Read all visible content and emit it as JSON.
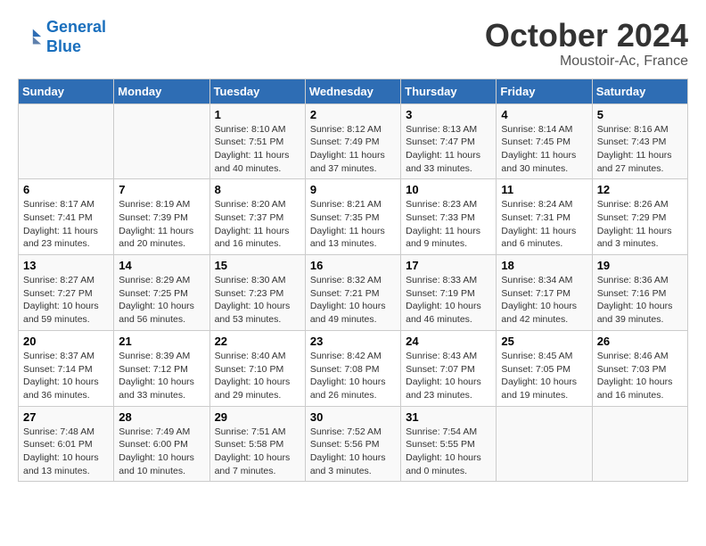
{
  "logo": {
    "line1": "General",
    "line2": "Blue"
  },
  "title": "October 2024",
  "location": "Moustoir-Ac, France",
  "days_of_week": [
    "Sunday",
    "Monday",
    "Tuesday",
    "Wednesday",
    "Thursday",
    "Friday",
    "Saturday"
  ],
  "weeks": [
    [
      {
        "day": "",
        "info": ""
      },
      {
        "day": "",
        "info": ""
      },
      {
        "day": "1",
        "info": "Sunrise: 8:10 AM\nSunset: 7:51 PM\nDaylight: 11 hours and 40 minutes."
      },
      {
        "day": "2",
        "info": "Sunrise: 8:12 AM\nSunset: 7:49 PM\nDaylight: 11 hours and 37 minutes."
      },
      {
        "day": "3",
        "info": "Sunrise: 8:13 AM\nSunset: 7:47 PM\nDaylight: 11 hours and 33 minutes."
      },
      {
        "day": "4",
        "info": "Sunrise: 8:14 AM\nSunset: 7:45 PM\nDaylight: 11 hours and 30 minutes."
      },
      {
        "day": "5",
        "info": "Sunrise: 8:16 AM\nSunset: 7:43 PM\nDaylight: 11 hours and 27 minutes."
      }
    ],
    [
      {
        "day": "6",
        "info": "Sunrise: 8:17 AM\nSunset: 7:41 PM\nDaylight: 11 hours and 23 minutes."
      },
      {
        "day": "7",
        "info": "Sunrise: 8:19 AM\nSunset: 7:39 PM\nDaylight: 11 hours and 20 minutes."
      },
      {
        "day": "8",
        "info": "Sunrise: 8:20 AM\nSunset: 7:37 PM\nDaylight: 11 hours and 16 minutes."
      },
      {
        "day": "9",
        "info": "Sunrise: 8:21 AM\nSunset: 7:35 PM\nDaylight: 11 hours and 13 minutes."
      },
      {
        "day": "10",
        "info": "Sunrise: 8:23 AM\nSunset: 7:33 PM\nDaylight: 11 hours and 9 minutes."
      },
      {
        "day": "11",
        "info": "Sunrise: 8:24 AM\nSunset: 7:31 PM\nDaylight: 11 hours and 6 minutes."
      },
      {
        "day": "12",
        "info": "Sunrise: 8:26 AM\nSunset: 7:29 PM\nDaylight: 11 hours and 3 minutes."
      }
    ],
    [
      {
        "day": "13",
        "info": "Sunrise: 8:27 AM\nSunset: 7:27 PM\nDaylight: 10 hours and 59 minutes."
      },
      {
        "day": "14",
        "info": "Sunrise: 8:29 AM\nSunset: 7:25 PM\nDaylight: 10 hours and 56 minutes."
      },
      {
        "day": "15",
        "info": "Sunrise: 8:30 AM\nSunset: 7:23 PM\nDaylight: 10 hours and 53 minutes."
      },
      {
        "day": "16",
        "info": "Sunrise: 8:32 AM\nSunset: 7:21 PM\nDaylight: 10 hours and 49 minutes."
      },
      {
        "day": "17",
        "info": "Sunrise: 8:33 AM\nSunset: 7:19 PM\nDaylight: 10 hours and 46 minutes."
      },
      {
        "day": "18",
        "info": "Sunrise: 8:34 AM\nSunset: 7:17 PM\nDaylight: 10 hours and 42 minutes."
      },
      {
        "day": "19",
        "info": "Sunrise: 8:36 AM\nSunset: 7:16 PM\nDaylight: 10 hours and 39 minutes."
      }
    ],
    [
      {
        "day": "20",
        "info": "Sunrise: 8:37 AM\nSunset: 7:14 PM\nDaylight: 10 hours and 36 minutes."
      },
      {
        "day": "21",
        "info": "Sunrise: 8:39 AM\nSunset: 7:12 PM\nDaylight: 10 hours and 33 minutes."
      },
      {
        "day": "22",
        "info": "Sunrise: 8:40 AM\nSunset: 7:10 PM\nDaylight: 10 hours and 29 minutes."
      },
      {
        "day": "23",
        "info": "Sunrise: 8:42 AM\nSunset: 7:08 PM\nDaylight: 10 hours and 26 minutes."
      },
      {
        "day": "24",
        "info": "Sunrise: 8:43 AM\nSunset: 7:07 PM\nDaylight: 10 hours and 23 minutes."
      },
      {
        "day": "25",
        "info": "Sunrise: 8:45 AM\nSunset: 7:05 PM\nDaylight: 10 hours and 19 minutes."
      },
      {
        "day": "26",
        "info": "Sunrise: 8:46 AM\nSunset: 7:03 PM\nDaylight: 10 hours and 16 minutes."
      }
    ],
    [
      {
        "day": "27",
        "info": "Sunrise: 7:48 AM\nSunset: 6:01 PM\nDaylight: 10 hours and 13 minutes."
      },
      {
        "day": "28",
        "info": "Sunrise: 7:49 AM\nSunset: 6:00 PM\nDaylight: 10 hours and 10 minutes."
      },
      {
        "day": "29",
        "info": "Sunrise: 7:51 AM\nSunset: 5:58 PM\nDaylight: 10 hours and 7 minutes."
      },
      {
        "day": "30",
        "info": "Sunrise: 7:52 AM\nSunset: 5:56 PM\nDaylight: 10 hours and 3 minutes."
      },
      {
        "day": "31",
        "info": "Sunrise: 7:54 AM\nSunset: 5:55 PM\nDaylight: 10 hours and 0 minutes."
      },
      {
        "day": "",
        "info": ""
      },
      {
        "day": "",
        "info": ""
      }
    ]
  ]
}
